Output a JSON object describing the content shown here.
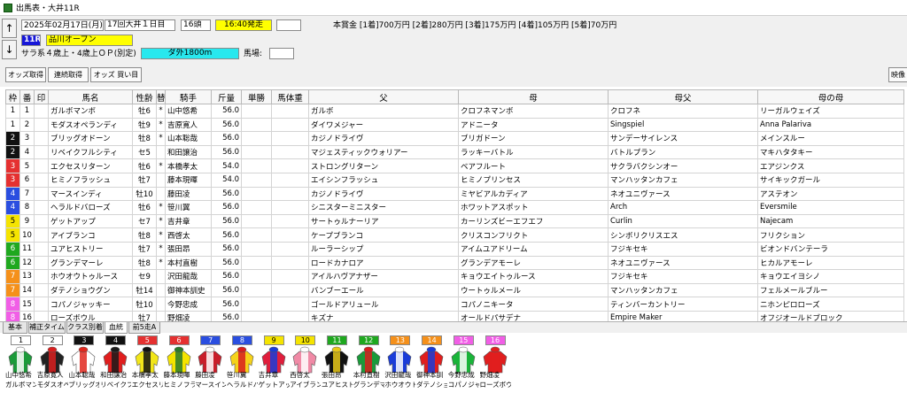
{
  "window": {
    "title": "出馬表・大井11R"
  },
  "header": {
    "date": "2025年02月17日(月)",
    "meeting": "17回大井１日目",
    "runners": "16頭",
    "post_time": "16:40発走",
    "race_no": "11R",
    "race_name": "品川オープン",
    "conditions": "サラ系４歳上・4歳上ＯＰ(別定)",
    "course": "ダ外1800m",
    "track_label": "馬場:",
    "prize": "本賞金 [1着]700万円 [2着]280万円 [3着]175万円 [4着]105万円 [5着]70万円"
  },
  "toolbar": {
    "odds": "オッズ取得",
    "combo": "連続取得",
    "buy": "オッズ 買い目",
    "right": "映像"
  },
  "columns": [
    "枠",
    "番",
    "印",
    "馬名",
    "性齢",
    "替",
    "騎手",
    "斤量",
    "単勝",
    "馬体重",
    "父",
    "母",
    "母父",
    "母の母"
  ],
  "colors": {
    "w1": "#ffffff",
    "w2": "#111111",
    "w3": "#e53030",
    "w4": "#2a4ee0",
    "w5": "#f5e400",
    "w6": "#1fa81f",
    "w7": "#f5901a",
    "w8": "#f15ee6",
    "post_bg": "#ffff00",
    "course_bg": "#28e8ee",
    "race_bg": "#1717d8"
  },
  "horses": [
    {
      "waku": "1",
      "ban": "1",
      "name": "ガルボマンボ",
      "sex": "牡6",
      "kae": "*",
      "jockey": "山中悠希",
      "kin": "56.0",
      "sire": "ガルボ",
      "dam": "クロフネマンボ",
      "bms": "クロフネ",
      "dd": "リーガルウェイズ",
      "jsh": "山中悠希",
      "hsh": "ガルボマンボ"
    },
    {
      "waku": "1",
      "ban": "2",
      "name": "モダスオペランディ",
      "sex": "牡9",
      "kae": "*",
      "jockey": "吉原寛人",
      "kin": "56.0",
      "sire": "ダイワメジャー",
      "dam": "アドニータ",
      "bms": "Singspiel",
      "dd": "Anna Palariva",
      "jsh": "吉原寛人",
      "hsh": "モダスオペ"
    },
    {
      "waku": "2",
      "ban": "3",
      "name": "ブリッグオドーン",
      "sex": "牡8",
      "kae": "*",
      "jockey": "山本聡哉",
      "kin": "56.0",
      "sire": "カジノドライヴ",
      "dam": "ブリガドーン",
      "bms": "サンデーサイレンス",
      "dd": "メインスルー",
      "jsh": "山本聡哉",
      "hsh": "ブリッグオ"
    },
    {
      "waku": "2",
      "ban": "4",
      "name": "リベイクフルシティ",
      "sex": "セ5",
      "kae": "",
      "jockey": "和田譲治",
      "kin": "56.0",
      "sire": "マジェスティックウォリアー",
      "dam": "ラッキーバトル",
      "bms": "バトルプラン",
      "dd": "マキハタタキー",
      "jsh": "和田譲治",
      "hsh": "リベイクフ"
    },
    {
      "waku": "3",
      "ban": "5",
      "name": "エクセスリターン",
      "sex": "牡6",
      "kae": "*",
      "jockey": "本橋孝太",
      "kin": "54.0",
      "sire": "ストロングリターン",
      "dam": "ベアフルート",
      "bms": "サクラバクシンオー",
      "dd": "エアジンクス",
      "jsh": "本橋孝太",
      "hsh": "エクセスリ"
    },
    {
      "waku": "3",
      "ban": "6",
      "name": "ヒミノフラッシュ",
      "sex": "牡7",
      "kae": "",
      "jockey": "藤本現暉",
      "kin": "54.0",
      "sire": "エイシンフラッシュ",
      "dam": "ヒミノプリンセス",
      "bms": "マンハッタンカフェ",
      "dd": "サイキックガール",
      "jsh": "藤本現暉",
      "hsh": "ヒミノフラ"
    },
    {
      "waku": "4",
      "ban": "7",
      "name": "マースインディ",
      "sex": "牡10",
      "kae": "",
      "jockey": "藤田凌",
      "kin": "56.0",
      "sire": "カジノドライヴ",
      "dam": "ミヤビアルカディア",
      "bms": "ネオユニヴァース",
      "dd": "アステオン",
      "jsh": "藤田凌",
      "hsh": "マースイン"
    },
    {
      "waku": "4",
      "ban": "8",
      "name": "ヘラルドバローズ",
      "sex": "牡6",
      "kae": "*",
      "jockey": "笹川翼",
      "kin": "56.0",
      "sire": "シニスターミニスター",
      "dam": "ホワットアスポット",
      "bms": "Arch",
      "dd": "Eversmile",
      "jsh": "笹川翼",
      "hsh": "ヘラルドバ"
    },
    {
      "waku": "5",
      "ban": "9",
      "name": "ゲットアップ",
      "sex": "セ7",
      "kae": "*",
      "jockey": "吉井章",
      "kin": "56.0",
      "sire": "サートゥルナーリア",
      "dam": "カーリンズビーエフエフ",
      "bms": "Curlin",
      "dd": "Najecam",
      "jsh": "吉井章",
      "hsh": "ゲットアッ"
    },
    {
      "waku": "5",
      "ban": "10",
      "name": "アイブランコ",
      "sex": "牡8",
      "kae": "*",
      "jockey": "西啓太",
      "kin": "56.0",
      "sire": "ケープブランコ",
      "dam": "クリスコンフリクト",
      "bms": "シンボリクリスエス",
      "dd": "フリクション",
      "jsh": "西啓太",
      "hsh": "アイブラン"
    },
    {
      "waku": "6",
      "ban": "11",
      "name": "ユアヒストリー",
      "sex": "牡7",
      "kae": "*",
      "jockey": "張田昂",
      "kin": "56.0",
      "sire": "ルーラーシップ",
      "dam": "アイムユアドリーム",
      "bms": "フジキセキ",
      "dd": "ビオンドバンテーラ",
      "jsh": "張田昂",
      "hsh": "ユアヒスト"
    },
    {
      "waku": "6",
      "ban": "12",
      "name": "グランデマーレ",
      "sex": "牡8",
      "kae": "*",
      "jockey": "本村直樹",
      "kin": "56.0",
      "sire": "ロードカナロア",
      "dam": "グランデアモーレ",
      "bms": "ネオユニヴァース",
      "dd": "ヒカルアモーレ",
      "jsh": "本村直樹",
      "hsh": "グランデマ"
    },
    {
      "waku": "7",
      "ban": "13",
      "name": "ホウオウトゥルース",
      "sex": "セ9",
      "kae": "",
      "jockey": "沢田龍哉",
      "kin": "56.0",
      "sire": "アイルハヴアナザー",
      "dam": "キョウエイトゥルース",
      "bms": "フジキセキ",
      "dd": "キョウエイヨシノ",
      "jsh": "沢田龍哉",
      "hsh": "ホウオウト"
    },
    {
      "waku": "7",
      "ban": "14",
      "name": "ダテノショウグン",
      "sex": "牡14",
      "kae": "",
      "jockey": "御神本訓史",
      "kin": "56.0",
      "sire": "バンブーエール",
      "dam": "ウートゥルメール",
      "bms": "マンハッタンカフェ",
      "dd": "フェルメールブルー",
      "jsh": "御神本訓",
      "hsh": "ダテノショ"
    },
    {
      "waku": "8",
      "ban": "15",
      "name": "コパノジャッキー",
      "sex": "牡10",
      "kae": "",
      "jockey": "今野忠成",
      "kin": "56.0",
      "sire": "ゴールドアリュール",
      "dam": "コパノニキータ",
      "bms": "ティンバーカントリー",
      "dd": "ニホンピロローズ",
      "jsh": "今野忠成",
      "hsh": "コパノジャ"
    },
    {
      "waku": "8",
      "ban": "16",
      "name": "ローズボウル",
      "sex": "牡7",
      "kae": "",
      "jockey": "野畑凌",
      "kin": "56.0",
      "sire": "キズナ",
      "dam": "オールドパサデナ",
      "bms": "Empire Maker",
      "dd": "オフジオールドブロック",
      "jsh": "野畑凌",
      "hsh": "ローズボウ"
    }
  ],
  "tabs": [
    "基本",
    "補正タイム",
    "クラス別着",
    "血統",
    "前5走A"
  ],
  "silks": [
    {
      "num": "1",
      "body": "#1c9a3a",
      "trim": "#ffffff"
    },
    {
      "num": "2",
      "body": "#222222",
      "trim": "#d81e1e"
    },
    {
      "num": "3",
      "body": "#ffffff",
      "trim": "#e0281e"
    },
    {
      "num": "4",
      "body": "#e01e1e",
      "trim": "#1a1a1a"
    },
    {
      "num": "5",
      "body": "#f2e61a",
      "trim": "#111111"
    },
    {
      "num": "6",
      "body": "#f5e400",
      "trim": "#2a7a2a"
    },
    {
      "num": "7",
      "body": "#c81e2a",
      "trim": "#ffffff"
    },
    {
      "num": "8",
      "body": "#f5d21a",
      "trim": "#d81e1e"
    },
    {
      "num": "9",
      "body": "#e01e3c",
      "trim": "#1a3cd8"
    },
    {
      "num": "10",
      "body": "#f08aa6",
      "trim": "#ffffff"
    },
    {
      "num": "11",
      "body": "#111111",
      "trim": "#e8c81a"
    },
    {
      "num": "12",
      "body": "#1a9a3a",
      "trim": "#d81e1e"
    },
    {
      "num": "13",
      "body": "#1a3cd8",
      "trim": "#ffffff"
    },
    {
      "num": "14",
      "body": "#e01e1e",
      "trim": "#1a3cd8"
    },
    {
      "num": "15",
      "body": "#1ab43a",
      "trim": "#ffffff"
    },
    {
      "num": "16",
      "body": "#e01e1e",
      "trim": "#e01e1e"
    }
  ]
}
